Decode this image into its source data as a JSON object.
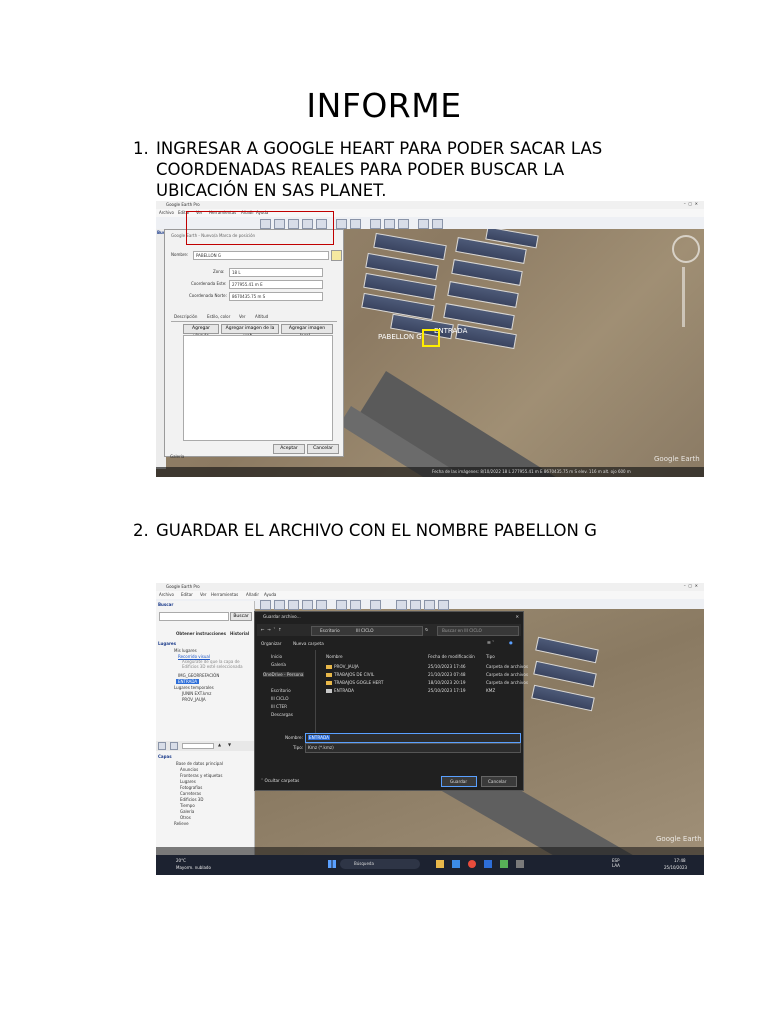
{
  "document": {
    "title": "INFORME",
    "steps": [
      {
        "number": "1.",
        "lines": [
          "INGRESAR  A GOOGLE HEART PARA PODER SACAR LAS",
          "COORDENADAS REALES PARA PODER BUSCAR LA",
          "UBICACIÓN EN SAS PLANET."
        ]
      },
      {
        "number": "2.",
        "lines": [
          "GUARDAR EL ARCHIVO  CON EL NOMBRE PABELLON G"
        ]
      }
    ]
  },
  "screenshot1": {
    "app_title": "Google Earth Pro",
    "menu": [
      "Archivo",
      "Editar",
      "Ver",
      "Herramientas",
      "Añadir",
      "Ayuda"
    ],
    "search_label": "Buscar",
    "dialog": {
      "title": "Google Earth - Nuevo/a Marca de posición",
      "name_label": "Nombre:",
      "name_value": "PABELLON G",
      "zone_label": "Zona:",
      "zone_value": "18 L",
      "east_label": "Coordenada Este:",
      "east_value": "277955.41 m E",
      "north_label": "Coordenada Norte:",
      "north_value": "8670435.75 m S",
      "tabs": [
        "Descripción",
        "Estilo, color",
        "Ver",
        "Altitud"
      ],
      "desc_buttons": [
        "Agregar vínculo",
        "Agregar imagen de la web...",
        "Agregar imagen local..."
      ],
      "ok": "Aceptar",
      "cancel": "Cancelar"
    },
    "map_labels": [
      "PABELLON G",
      "ENTRADA"
    ],
    "watermark": "Google Earth",
    "status": "Fecha de las imágenes: 8/10/2022   18 L 277955.41 m E 8670435.75 m S  elev. 116 m  alt. ojo 600 m",
    "left_item": "Galería"
  },
  "screenshot2": {
    "app_title": "Google Earth Pro",
    "menu": [
      "Archivo",
      "Editar",
      "Ver",
      "Herramientas",
      "Añadir",
      "Ayuda"
    ],
    "search_label": "Buscar",
    "search_btn": "Buscar",
    "directions": "Obtener instrucciones",
    "history": "Historial",
    "places_label": "Lugares",
    "places": [
      "Mis lugares",
      "Recorrido visual",
      "Asegúrate de que la capa de Edificios 3D esté seleccionada",
      "IMG_GEORREFACIÓN",
      "ENTRADA",
      "Lugares temporales",
      "JUNIN EXT.kmz",
      "PROV_JAUJA"
    ],
    "layers_label": "Capas",
    "layers": [
      "Base de datos principal",
      "Anuncios",
      "Fronteras y etiquetas",
      "Lugares",
      "Fotografías",
      "Carreteras",
      "Edificios 3D",
      "Tiempo",
      "Galería",
      "Otros",
      "Relieve"
    ],
    "save_dialog": {
      "title": "Guardar archivo...",
      "path": [
        "Escritorio",
        "III CICLO"
      ],
      "search_placeholder": "Buscar en III CICLO",
      "organize": "Organizar",
      "new_folder": "Nueva carpeta",
      "columns": [
        "Nombre",
        "Fecha de modificación",
        "Tipo"
      ],
      "files": [
        {
          "name": "PROV_JAUJA",
          "date": "25/10/2023 17:46",
          "type": "Carpeta de archivos"
        },
        {
          "name": "TRABAJOS DE CIVIL",
          "date": "21/10/2023 07:48",
          "type": "Carpeta de archivos"
        },
        {
          "name": "TRABAJOS GOGLE HERT",
          "date": "18/10/2023 20:19",
          "type": "Carpeta de archivos"
        },
        {
          "name": "ENTRADA",
          "date": "25/10/2023 17:19",
          "type": "KMZ"
        }
      ],
      "nav": [
        "Inicio",
        "Galería",
        "Escritorio",
        "III CICLO",
        "III CTER",
        "Descargas"
      ],
      "onedrive": "OneDrive - Persona",
      "name_label": "Nombre:",
      "name_value": "ENTRADA",
      "type_label": "Tipo:",
      "type_value": "Kmz (*.kmz)",
      "hide_folders": "Ocultar carpetas",
      "save": "Guardar",
      "cancel": "Cancelar"
    },
    "taskbar": {
      "weather_temp": "20°C",
      "weather_desc": "Mayorm. nublado",
      "search": "Búsqueda",
      "lang": "ESP\nLAA",
      "time": "17:48",
      "date": "25/10/2023"
    },
    "watermark": "Google Earth"
  },
  "colors": {
    "highlight_box": "#c00000",
    "marker": "#ffee00",
    "roof": "#44506c",
    "desert": "#8c7a62"
  }
}
